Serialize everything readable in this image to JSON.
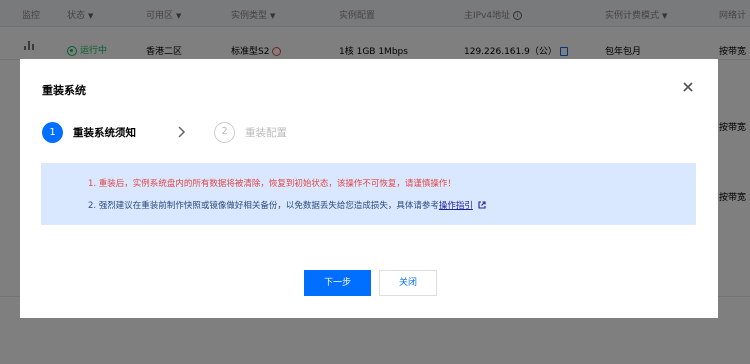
{
  "table": {
    "columns": [
      {
        "label": "监控",
        "filter": false
      },
      {
        "label": "状态",
        "filter": true
      },
      {
        "label": "可用区",
        "filter": true
      },
      {
        "label": "实例类型",
        "filter": true
      },
      {
        "label": "实例配置",
        "filter": false
      },
      {
        "label": "主IPv4地址",
        "filter": false,
        "info": true
      },
      {
        "label": "实例计费模式",
        "filter": true
      },
      {
        "label": "网络计",
        "filter": false
      }
    ],
    "filter_glyph": "▼",
    "row1": {
      "status": "运行中",
      "zone": "香港二区",
      "instance_type": "标准型S2",
      "config": "1核 1GB 1Mbps",
      "ip": "129.226.161.9（公）",
      "billing": "包年包月",
      "network": "按带宽"
    },
    "row2": {
      "network": "按带宽"
    },
    "row3": {
      "network": "按带宽"
    }
  },
  "modal": {
    "title": "重装系统",
    "close_glyph": "✕",
    "steps": [
      {
        "number": "1",
        "label": "重装系统须知",
        "active": true
      },
      {
        "number": "2",
        "label": "重装配置",
        "active": false
      }
    ],
    "notice": {
      "line1": "1. 重装后，实例系统盘内的所有数据将被清除，恢复到初始状态，该操作不可恢复，请谨慎操作！",
      "line2_prefix": "2. 强烈建议在重装前制作快照或镜像做好相关备份，以免数据丢失给您造成损失，具体请参考",
      "line2_link": "操作指引"
    },
    "buttons": {
      "next": "下一步",
      "close": "关闭"
    }
  },
  "colors": {
    "primary": "#006eff",
    "danger": "#e54545",
    "running": "#0abf5b",
    "notice_bg": "#d9e8ff"
  }
}
